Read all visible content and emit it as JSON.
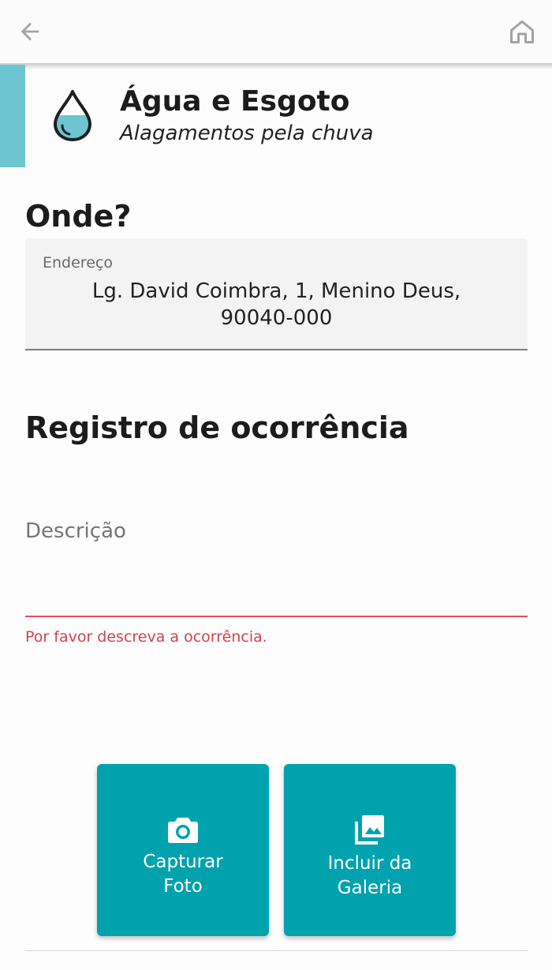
{
  "category": {
    "title": "Água e Esgoto",
    "subtitle": "Alagamentos pela chuva",
    "icon": "water-drop-icon",
    "accent_color": "#6cc5d1"
  },
  "where": {
    "title": "Onde?",
    "address_label": "Endereço",
    "address_value": "Lg. David Coimbra, 1, Menino Deus,\n90040-000"
  },
  "register": {
    "title": "Registro de ocorrência",
    "description_label": "Descrição",
    "description_value": "",
    "description_error": "Por favor descreva a ocorrência.",
    "error_color": "#d9535b"
  },
  "actions": {
    "capture_label": "Capturar\nFoto",
    "gallery_label": "Incluir da\nGaleria",
    "button_color": "#00a2ae"
  },
  "navigation": {
    "back_icon": "arrow-left-icon",
    "home_icon": "home-icon"
  }
}
